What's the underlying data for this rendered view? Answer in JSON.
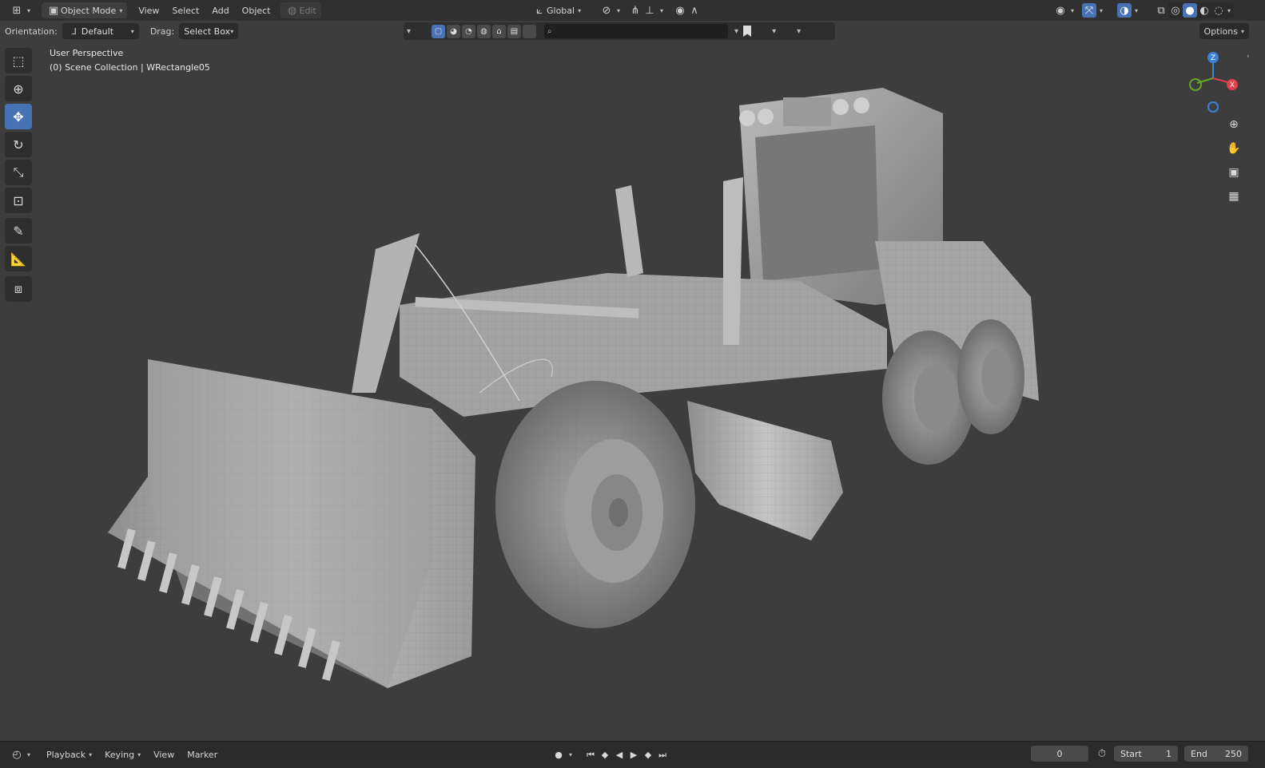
{
  "header": {
    "mode": "Object Mode",
    "menus": [
      "View",
      "Select",
      "Add",
      "Object"
    ],
    "edit_label": "Edit",
    "transform_orientation": "Global",
    "options_label": "Options"
  },
  "toolheader": {
    "orientation_label": "Orientation:",
    "orientation_value": "Default",
    "drag_label": "Drag:",
    "drag_value": "Select Box",
    "search_placeholder": ""
  },
  "viewport": {
    "view_name": "User Perspective",
    "collection_info": "(0) Scene Collection | WRectangle05",
    "background": "#3d3d3d",
    "gizmo": {
      "z": "Z",
      "x": "X"
    }
  },
  "toolbar": {
    "tools": [
      "select-box-icon",
      "cursor-icon",
      "move-icon",
      "rotate-icon",
      "scale-icon",
      "transform-icon",
      "annotate-icon",
      "measure-icon",
      "add-cube-icon"
    ],
    "active_tool": "move-icon"
  },
  "timeline": {
    "menus": [
      "Playback",
      "Keying",
      "View",
      "Marker"
    ],
    "current_frame": "0",
    "start_label": "Start",
    "start_value": "1",
    "end_label": "End",
    "end_value": "250"
  },
  "colors": {
    "accent": "#4772b3",
    "axis_x": "#e0414a",
    "axis_y": "#6aa62a",
    "axis_z": "#3b83d8"
  }
}
